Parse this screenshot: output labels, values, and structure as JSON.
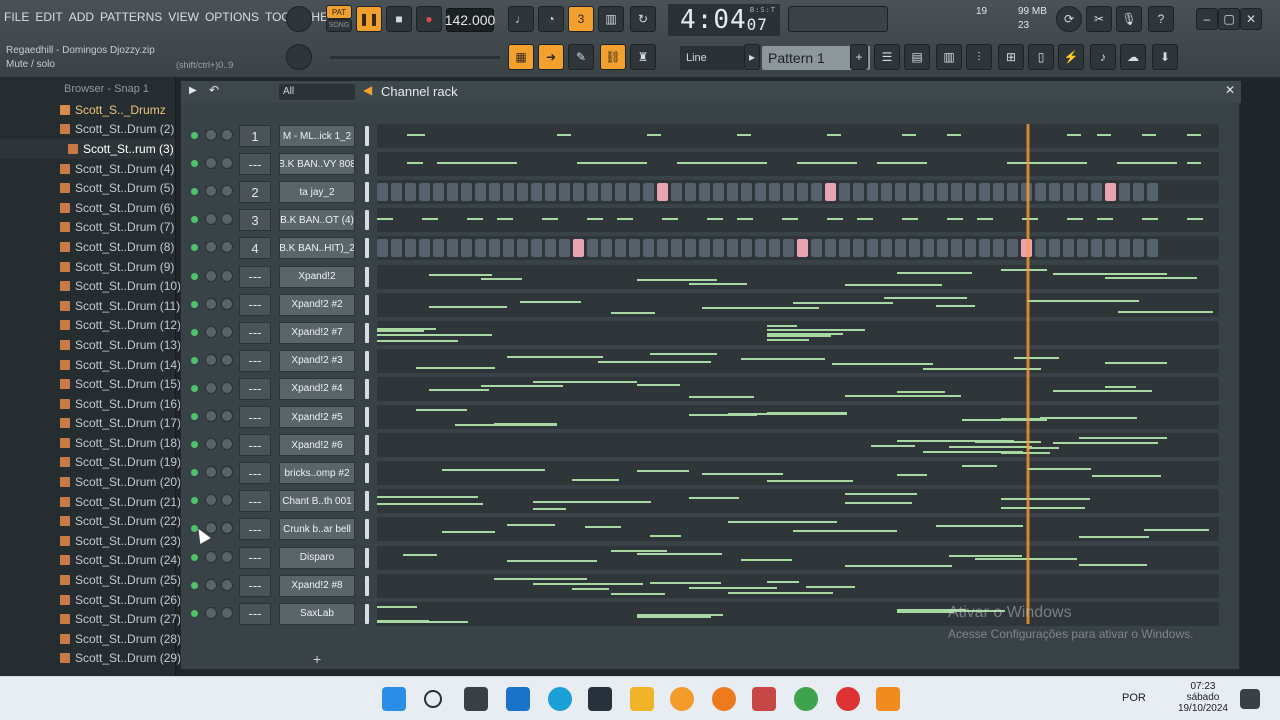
{
  "menu": [
    "FILE",
    "EDIT",
    "ADD",
    "PATTERNS",
    "VIEW",
    "OPTIONS",
    "TOOLS",
    "HELP"
  ],
  "hint": {
    "line1": "Regaedhill - Domingos Djozzy.zip",
    "line2": "Mute / solo",
    "shortcut": "(shift/ctrl+)0..9"
  },
  "transport": {
    "pat_label": "PAT",
    "song_label": "SONG",
    "tempo": "142.000",
    "time": "4:04",
    "time_small": "07",
    "bst": "B:S:T"
  },
  "cpu": {
    "cpu": "19",
    "ram": "99 MB",
    "poly": "23"
  },
  "snap": "Line",
  "pattern": "Pattern 1",
  "browser": {
    "title": "Browser - Snap 1",
    "items": [
      "Scott_S.._Drumz",
      "Scott_St..Drum (2)",
      "Scott_St..rum (3)",
      "Scott_St..Drum (4)",
      "Scott_St..Drum (5)",
      "Scott_St..Drum (6)",
      "Scott_St..Drum (7)",
      "Scott_St..Drum (8)",
      "Scott_St..Drum (9)",
      "Scott_St..Drum (10)",
      "Scott_St..Drum (11)",
      "Scott_St..Drum (12)",
      "Scott_St..Drum (13)",
      "Scott_St..Drum (14)",
      "Scott_St..Drum (15)",
      "Scott_St..Drum (16)",
      "Scott_St..Drum (17)",
      "Scott_St..Drum (18)",
      "Scott_St..Drum (19)",
      "Scott_St..Drum (20)",
      "Scott_St..Drum (21)",
      "Scott_St..Drum (22)",
      "Scott_St..Drum (23)",
      "Scott_St..Drum (24)",
      "Scott_St..Drum (25)",
      "Scott_St..Drum (26)",
      "Scott_St..Drum (27)",
      "Scott_St..Drum (28)",
      "Scott_St..Drum (29)"
    ]
  },
  "rack": {
    "filter": "All",
    "title": "Channel rack",
    "channels": [
      {
        "mix": "1",
        "name": "M - ML..ick 1_2"
      },
      {
        "mix": "---",
        "name": "B.K BAN..VY 808"
      },
      {
        "mix": "2",
        "name": "ta jay_2"
      },
      {
        "mix": "3",
        "name": "B.K BAN..OT (4)"
      },
      {
        "mix": "4",
        "name": "B.K BAN..HIT)_2"
      },
      {
        "mix": "---",
        "name": "Xpand!2"
      },
      {
        "mix": "---",
        "name": "Xpand!2 #2"
      },
      {
        "mix": "---",
        "name": "Xpand!2 #7"
      },
      {
        "mix": "---",
        "name": "Xpand!2 #3"
      },
      {
        "mix": "---",
        "name": "Xpand!2 #4"
      },
      {
        "mix": "---",
        "name": "Xpand!2 #5"
      },
      {
        "mix": "---",
        "name": "Xpand!2 #6"
      },
      {
        "mix": "---",
        "name": "bricks..omp #2"
      },
      {
        "mix": "---",
        "name": "Chant B..th 001"
      },
      {
        "mix": "---",
        "name": "Crunk b..ar bell"
      },
      {
        "mix": "---",
        "name": "Disparo"
      },
      {
        "mix": "---",
        "name": "Xpand!2 #8"
      },
      {
        "mix": "---",
        "name": "SaxLab"
      }
    ]
  },
  "watermark": {
    "title": "Ativar o Windows",
    "subtitle": "Acesse Configurações para ativar o Windows."
  },
  "taskbar": {
    "lang": "POR",
    "time": "07:23",
    "day": "sábado",
    "date": "19/10/2024"
  }
}
